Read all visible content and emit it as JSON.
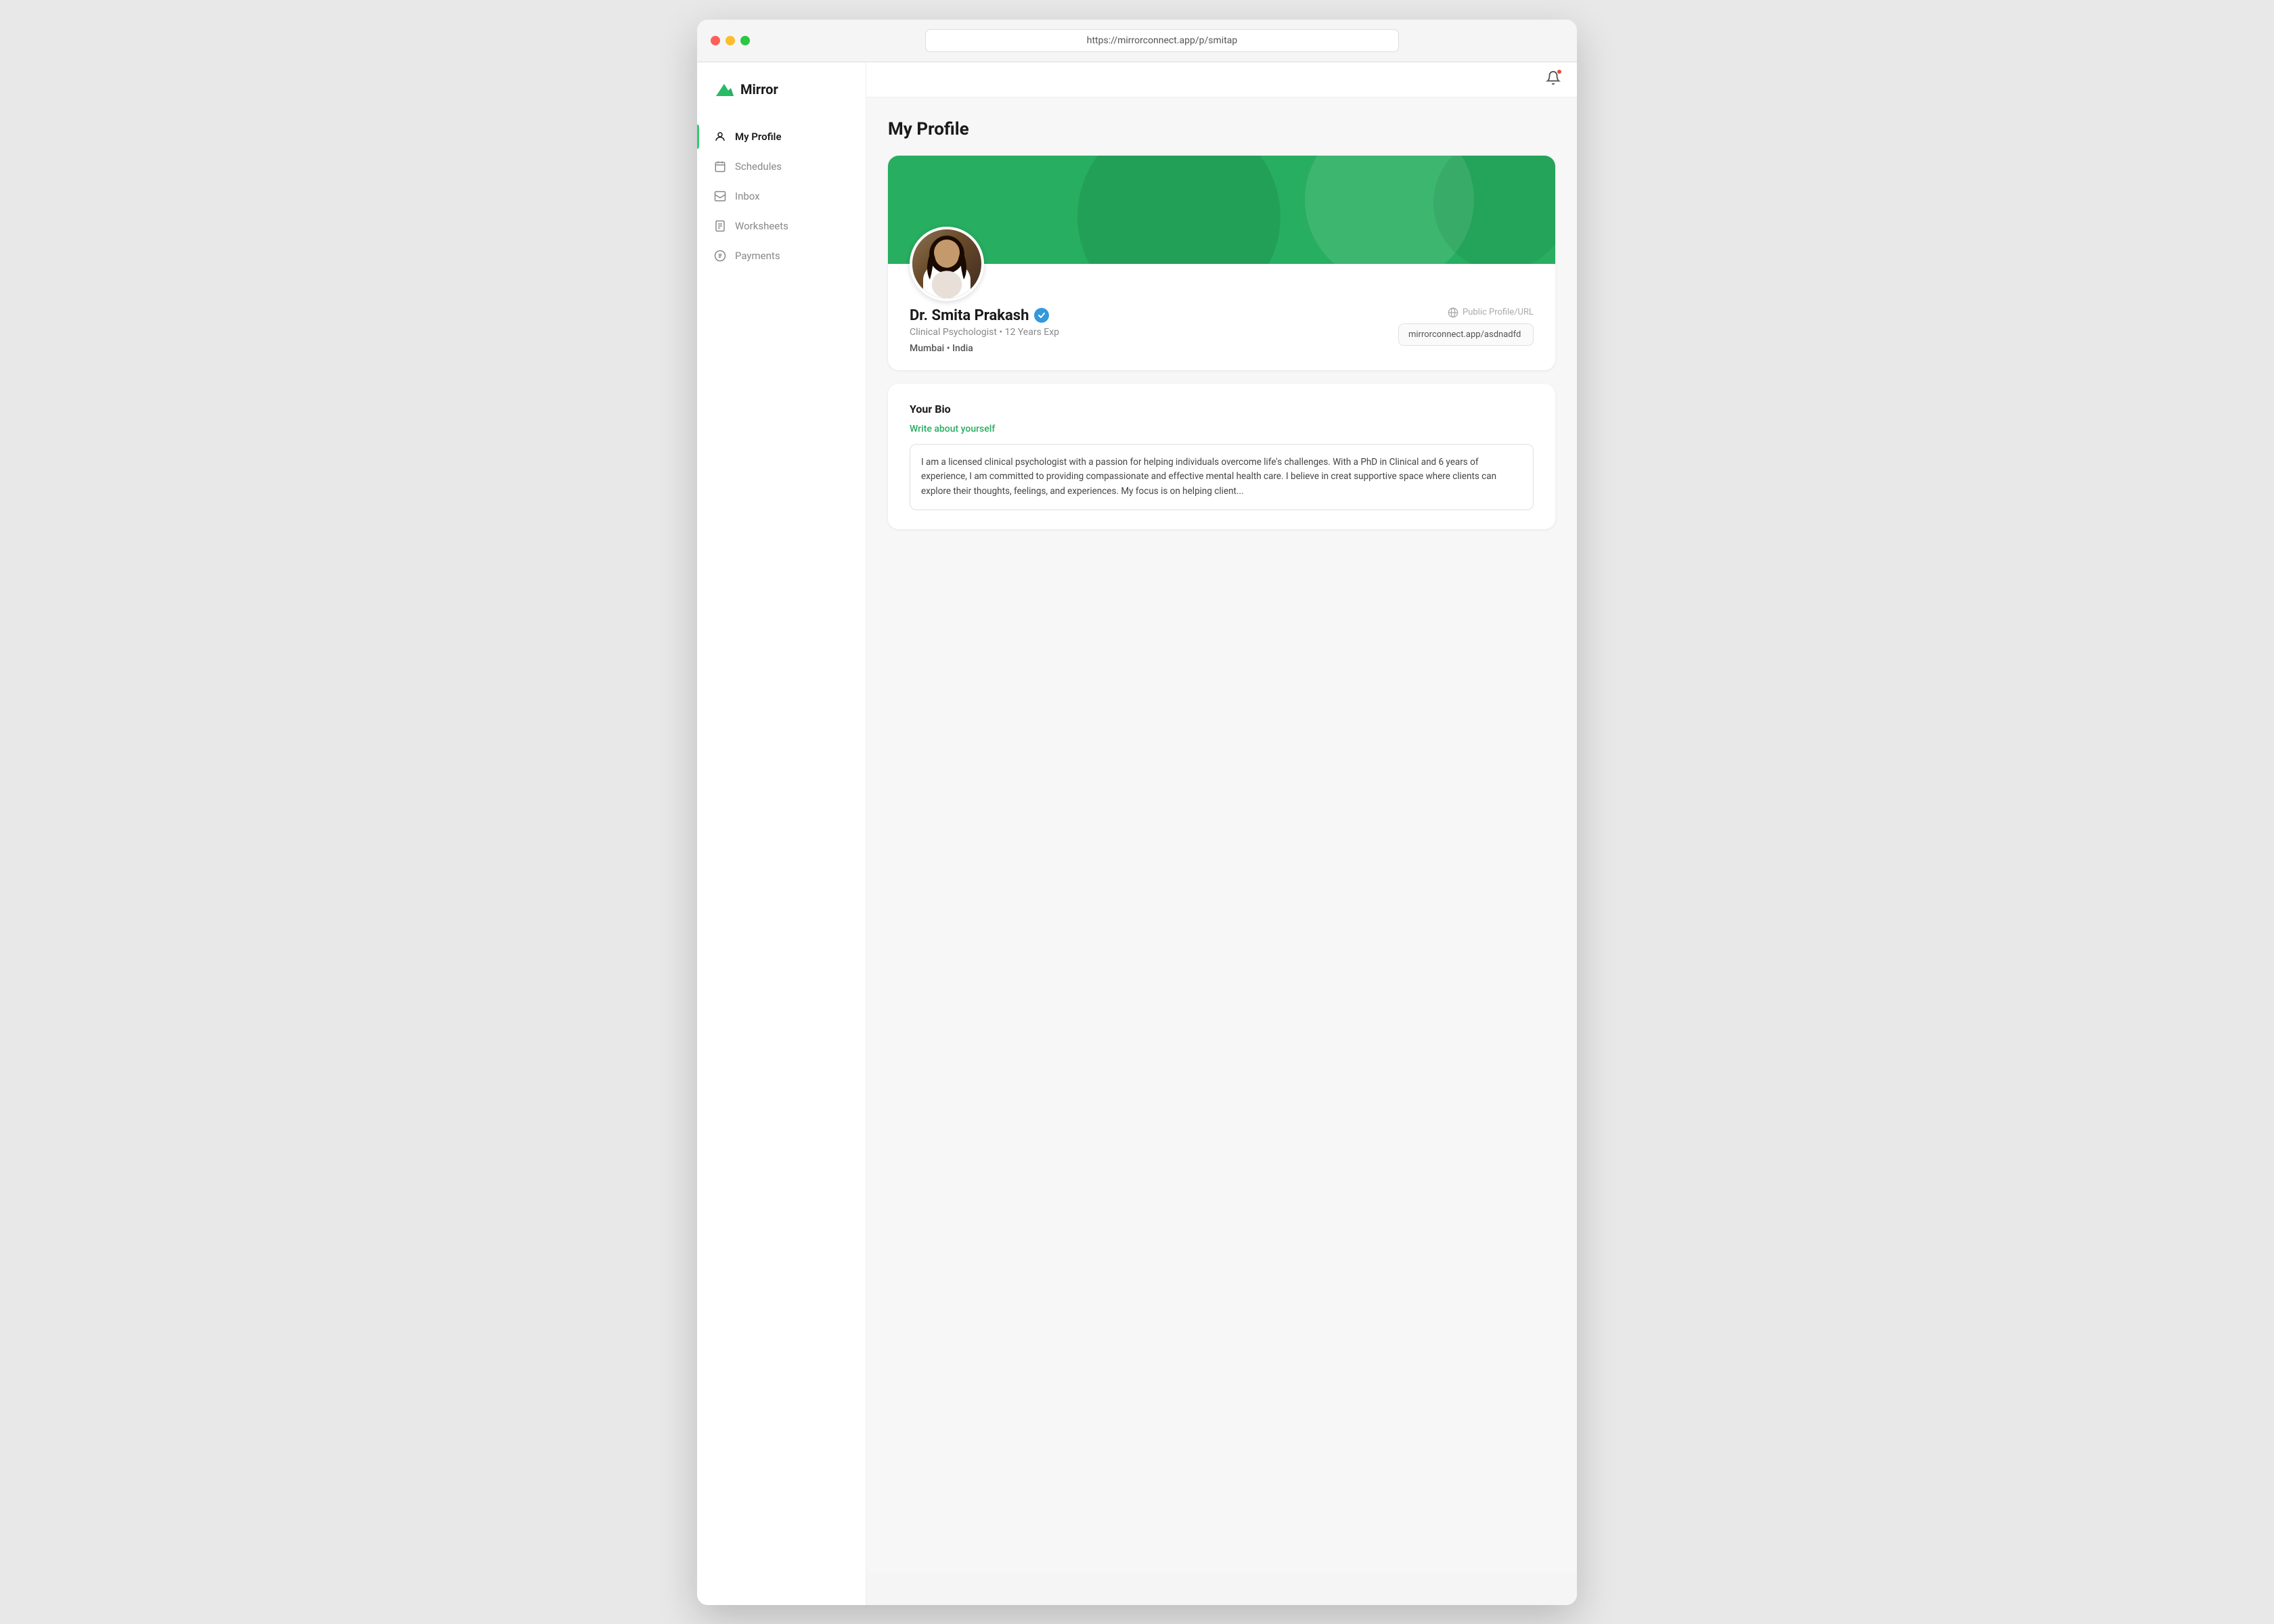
{
  "browser": {
    "url": "https://mirrorconnect.app/p/smitap",
    "traffic_lights": [
      "red",
      "yellow",
      "green"
    ]
  },
  "app": {
    "logo_text": "Mirror",
    "notification_badge": true
  },
  "sidebar": {
    "items": [
      {
        "id": "my-profile",
        "label": "My Profile",
        "active": true
      },
      {
        "id": "schedules",
        "label": "Schedules",
        "active": false
      },
      {
        "id": "inbox",
        "label": "Inbox",
        "active": false
      },
      {
        "id": "worksheets",
        "label": "Worksheets",
        "active": false
      },
      {
        "id": "payments",
        "label": "Payments",
        "active": false
      }
    ]
  },
  "page": {
    "title": "My Profile"
  },
  "profile": {
    "name": "Dr. Smita Prakash",
    "verified": true,
    "specialty": "Clinical Psychologist",
    "experience": "12 Years Exp",
    "city": "Mumbai",
    "country": "India",
    "public_url_label": "Public Profile/URL",
    "public_url": "mirrorconnect.app/asdnadfd"
  },
  "bio": {
    "section_title": "Your Bio",
    "write_prompt": "Write about yourself",
    "text": "I am a licensed clinical psychologist with a passion for helping individuals overcome life's challenges. With a PhD in Clinical and 6 years of experience, I am committed to providing compassionate and effective mental health care. I believe in creat supportive space where clients can explore their thoughts, feelings, and experiences. My focus is on helping client..."
  }
}
